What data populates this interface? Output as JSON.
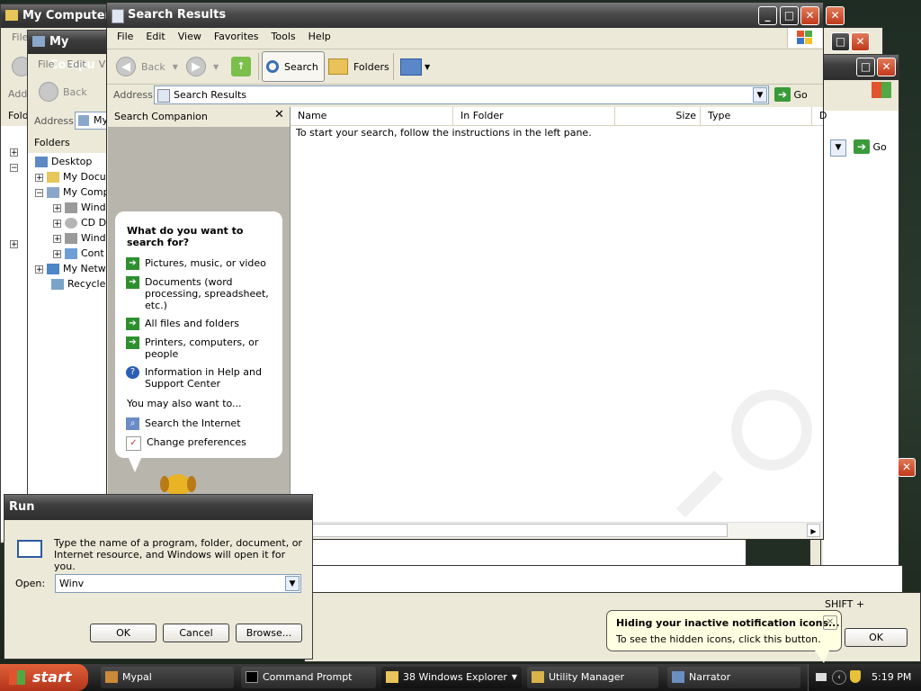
{
  "bg_windows": {
    "my_computer_1_title": "My Computer",
    "my_computer_1_menu": "File",
    "my_computer_1_address_fragment": "Add",
    "my_computer_1_folders_fragment": "Fold",
    "my_computer_2_title": "My Compu",
    "my_computer_2_menu": [
      "File",
      "Edit",
      "V"
    ],
    "my_computer_2_back": "Back",
    "my_computer_2_address_label": "Address",
    "my_computer_2_address_value": "My",
    "folders_header": "Folders",
    "tree": [
      {
        "label": "Desktop",
        "sign": ""
      },
      {
        "label": "My Docu",
        "sign": "+"
      },
      {
        "label": "My Comp",
        "sign": "−"
      },
      {
        "label": "Wind",
        "sign": "+"
      },
      {
        "label": "CD D",
        "sign": "+"
      },
      {
        "label": "Wind",
        "sign": "+"
      },
      {
        "label": "Cont",
        "sign": "+"
      },
      {
        "label": "My Netw",
        "sign": "+"
      },
      {
        "label": "Recycle B",
        "sign": ""
      }
    ],
    "right_go": "Go",
    "shift_text": "SHIFT +",
    "ok_label": "OK"
  },
  "search_window": {
    "title": "Search Results",
    "menu": [
      "File",
      "Edit",
      "View",
      "Favorites",
      "Tools",
      "Help"
    ],
    "toolbar": {
      "back": "Back",
      "search": "Search",
      "folders": "Folders"
    },
    "address_label": "Address",
    "address_value": "Search Results",
    "go_label": "Go",
    "companion_title": "Search Companion",
    "question": "What do you want to search for?",
    "options": [
      "Pictures, music, or video",
      "Documents (word processing, spreadsheet, etc.)",
      "All files and folders",
      "Printers, computers, or people",
      "Information in Help and Support Center"
    ],
    "also_label": "You may also want to...",
    "also_options": [
      "Search the Internet",
      "Change preferences"
    ],
    "columns": [
      "Name",
      "In Folder",
      "Size",
      "Type",
      "D"
    ],
    "instructions": "To start your search, follow the instructions in the left pane."
  },
  "run_dialog": {
    "title": "Run",
    "description": "Type the name of a program, folder, document, or Internet resource, and Windows will open it for you.",
    "open_label": "Open:",
    "open_value": "Winv",
    "ok": "OK",
    "cancel": "Cancel",
    "browse": "Browse..."
  },
  "notification": {
    "title": "Hiding your inactive notification icons...",
    "body": "To see the hidden icons, click this button."
  },
  "taskbar": {
    "start": "start",
    "items": [
      "Mypal",
      "Command Prompt",
      "38 Windows Explorer",
      "Utility Manager",
      "Narrator"
    ],
    "clock": "5:19 PM"
  }
}
